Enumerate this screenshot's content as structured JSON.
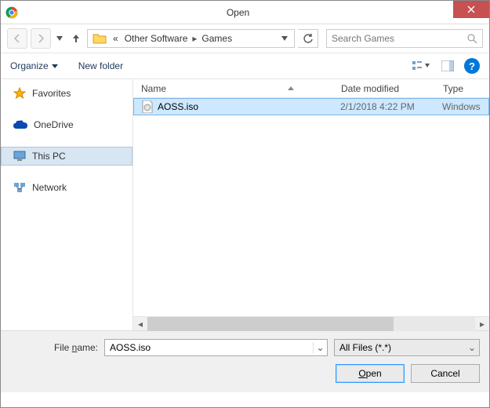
{
  "window": {
    "title": "Open"
  },
  "nav": {
    "breadcrumb_prefix": "«",
    "crumbs": [
      "Other Software",
      "Games"
    ],
    "search_placeholder": "Search Games"
  },
  "toolbar": {
    "organize": "Organize",
    "new_folder": "New folder"
  },
  "sidebar": {
    "items": [
      {
        "label": "Favorites",
        "icon": "star"
      },
      {
        "label": "OneDrive",
        "icon": "onedrive"
      },
      {
        "label": "This PC",
        "icon": "pc",
        "selected": true
      },
      {
        "label": "Network",
        "icon": "network"
      }
    ]
  },
  "columns": {
    "name": "Name",
    "date": "Date modified",
    "type": "Type"
  },
  "files": [
    {
      "name": "AOSS.iso",
      "date": "2/1/2018 4:22 PM",
      "type": "Windows",
      "selected": true
    }
  ],
  "bottom": {
    "filename_label": "File name:",
    "filename_value": "AOSS.iso",
    "filter_label": "All Files (*.*)",
    "open_label": "Open",
    "cancel_label": "Cancel"
  }
}
